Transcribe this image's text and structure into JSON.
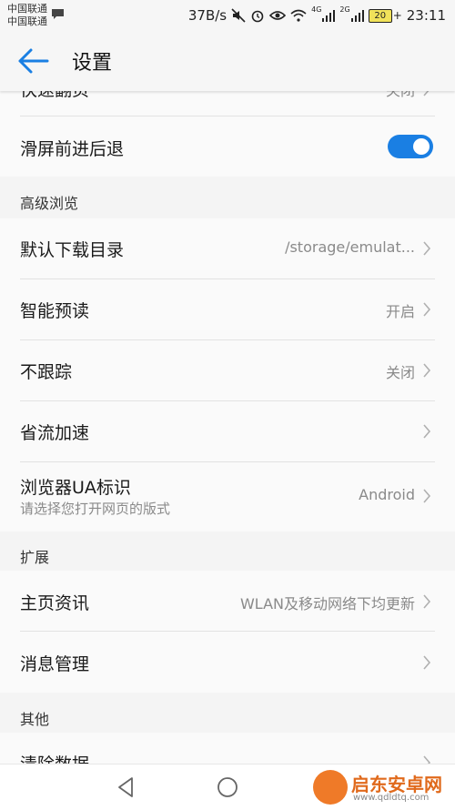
{
  "status_bar": {
    "carrier1": "中国联通",
    "carrier2": "中国联通",
    "net_speed": "37B/s",
    "signal1_label": "4G",
    "signal2_label": "2G",
    "battery": "20",
    "time": "23:11"
  },
  "toolbar": {
    "title": "设置"
  },
  "settings": {
    "partial_top": {
      "label": "快速翻页",
      "value": "关闭"
    },
    "swipe_nav": {
      "label": "滑屏前进后退",
      "toggle_on": true
    },
    "advanced": {
      "header": "高级浏览",
      "items": [
        {
          "label": "默认下载目录",
          "value": "/storage/emulat..."
        },
        {
          "label": "智能预读",
          "value": "开启"
        },
        {
          "label": "不跟踪",
          "value": "关闭"
        },
        {
          "label": "省流加速",
          "value": ""
        },
        {
          "label": "浏览器UA标识",
          "sub": "请选择您打开网页的版式",
          "value": "Android"
        }
      ]
    },
    "extension": {
      "header": "扩展",
      "items": [
        {
          "label": "主页资讯",
          "value": "WLAN及移动网络下均更新"
        },
        {
          "label": "消息管理",
          "value": ""
        }
      ]
    },
    "other": {
      "header": "其他",
      "items": [
        {
          "label": "清除数据"
        }
      ]
    }
  },
  "watermark": {
    "title": "启东安卓网",
    "url": "www.qdldtq.com"
  },
  "colors": {
    "accent": "#1a7fe3",
    "background": "#f4f4f4",
    "card": "#fafafa"
  }
}
